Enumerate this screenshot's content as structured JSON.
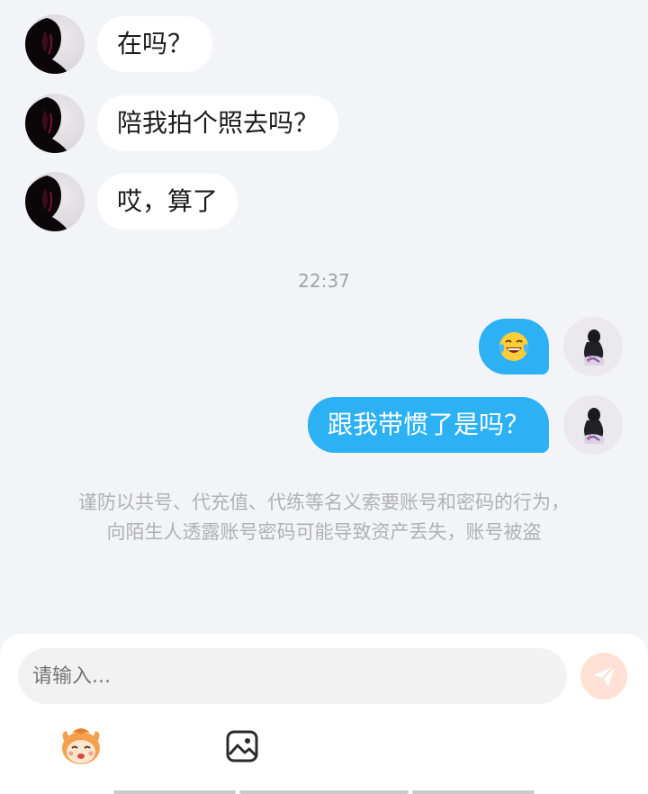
{
  "conversation": {
    "incoming": [
      {
        "text": "在吗？"
      },
      {
        "text": "陪我拍个照去吗？"
      },
      {
        "text": "哎，算了"
      }
    ],
    "timestamp": "22:37",
    "outgoing": [
      {
        "emoji": "face-with-tears-of-joy"
      },
      {
        "text": "跟我带惯了是吗？"
      }
    ],
    "security_notice": {
      "line1": "谨防以共号、代充值、代练等名义索要账号和密码的行为，",
      "line2": "向陌生人透露账号密码可能导致资产丢失，账号被盗"
    }
  },
  "composer": {
    "placeholder": "请输入..."
  },
  "icons": {
    "send": "send-icon",
    "sticker": "sticker-mascot-icon",
    "image": "image-icon"
  },
  "colors": {
    "outgoing_bubble": "#2bb1f4",
    "incoming_bubble": "#ffffff",
    "background": "#f3f4f8",
    "send_button": "#ffe1d6"
  }
}
